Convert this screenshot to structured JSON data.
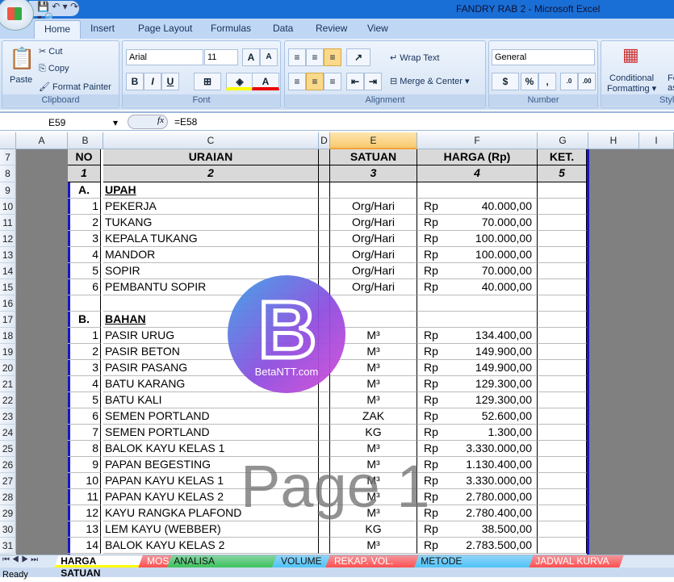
{
  "window": {
    "title": "FANDRY RAB 2 - Microsoft Excel",
    "qat": "💾 ↶ ▾ ↷ ▾ 🔍"
  },
  "ribbon_tabs": [
    "Home",
    "Insert",
    "Page Layout",
    "Formulas",
    "Data",
    "Review",
    "View"
  ],
  "ribbon": {
    "clipboard": {
      "label": "Clipboard",
      "paste": "Paste",
      "cut": "Cut",
      "copy": "Copy",
      "format_painter": "Format Painter"
    },
    "font": {
      "label": "Font",
      "name": "Arial",
      "size": "11"
    },
    "alignment": {
      "label": "Alignment",
      "wrap": "Wrap Text",
      "merge": "Merge & Center"
    },
    "number": {
      "label": "Number",
      "format": "General"
    },
    "styles": {
      "label": "Styles",
      "conditional": "Conditional",
      "formatting": "Formatting",
      "format_as": "Fo",
      "as_table": "as T"
    }
  },
  "formula_bar": {
    "name_box": "E59",
    "fx": "fx",
    "formula": "=E58"
  },
  "columns": [
    "A",
    "B",
    "C",
    "D",
    "E",
    "F",
    "G",
    "H",
    "I"
  ],
  "selected_column": "E",
  "header_row": {
    "no": "NO",
    "uraian": "URAIAN",
    "satuan": "SATUAN",
    "harga": "HARGA (Rp)",
    "ket": "KET."
  },
  "number_row": [
    "1",
    "2",
    "3",
    "4",
    "5"
  ],
  "rows": [
    {
      "r": "9",
      "b": "A.",
      "c": "UPAH",
      "section": true
    },
    {
      "r": "10",
      "b": "1",
      "c": "PEKERJA",
      "e": "Org/Hari",
      "rp": "Rp",
      "f": "40.000,00"
    },
    {
      "r": "11",
      "b": "2",
      "c": "TUKANG",
      "e": "Org/Hari",
      "rp": "Rp",
      "f": "70.000,00"
    },
    {
      "r": "12",
      "b": "3",
      "c": "KEPALA TUKANG",
      "e": "Org/Hari",
      "rp": "Rp",
      "f": "100.000,00"
    },
    {
      "r": "13",
      "b": "4",
      "c": "MANDOR",
      "e": "Org/Hari",
      "rp": "Rp",
      "f": "100.000,00"
    },
    {
      "r": "14",
      "b": "5",
      "c": "SOPIR",
      "e": "Org/Hari",
      "rp": "Rp",
      "f": "70.000,00"
    },
    {
      "r": "15",
      "b": "6",
      "c": "PEMBANTU SOPIR",
      "e": "Org/Hari",
      "rp": "Rp",
      "f": "40.000,00"
    },
    {
      "r": "16"
    },
    {
      "r": "17",
      "b": "B.",
      "c": "BAHAN",
      "section": true
    },
    {
      "r": "18",
      "b": "1",
      "c": "PASIR URUG",
      "e": "M³",
      "rp": "Rp",
      "f": "134.400,00"
    },
    {
      "r": "19",
      "b": "2",
      "c": "PASIR BETON",
      "e": "M³",
      "rp": "Rp",
      "f": "149.900,00"
    },
    {
      "r": "20",
      "b": "3",
      "c": "PASIR PASANG",
      "e": "M³",
      "rp": "Rp",
      "f": "149.900,00"
    },
    {
      "r": "21",
      "b": "4",
      "c": "BATU KARANG",
      "e": "M³",
      "rp": "Rp",
      "f": "129.300,00"
    },
    {
      "r": "22",
      "b": "5",
      "c": "BATU KALI",
      "e": "M³",
      "rp": "Rp",
      "f": "129.300,00"
    },
    {
      "r": "23",
      "b": "6",
      "c": "SEMEN PORTLAND",
      "e": "ZAK",
      "rp": "Rp",
      "f": "52.600,00"
    },
    {
      "r": "24",
      "b": "7",
      "c": "SEMEN PORTLAND",
      "e": "KG",
      "rp": "Rp",
      "f": "1.300,00"
    },
    {
      "r": "25",
      "b": "8",
      "c": "BALOK KAYU KELAS 1",
      "e": "M³",
      "rp": "Rp",
      "f": "3.330.000,00"
    },
    {
      "r": "26",
      "b": "9",
      "c": "PAPAN BEGESTING",
      "e": "M³",
      "rp": "Rp",
      "f": "1.130.400,00"
    },
    {
      "r": "27",
      "b": "10",
      "c": "PAPAN KAYU KELAS 1",
      "e": "M³",
      "rp": "Rp",
      "f": "3.330.000,00"
    },
    {
      "r": "28",
      "b": "11",
      "c": "PAPAN KAYU KELAS 2",
      "e": "M³",
      "rp": "Rp",
      "f": "2.780.000,00"
    },
    {
      "r": "29",
      "b": "12",
      "c": "KAYU RANGKA PLAFOND",
      "e": "M³",
      "rp": "Rp",
      "f": "2.780.400,00"
    },
    {
      "r": "30",
      "b": "13",
      "c": "LEM KAYU (WEBBER)",
      "e": "KG",
      "rp": "Rp",
      "f": "38.500,00"
    },
    {
      "r": "31",
      "b": "14",
      "c": "BALOK KAYU KELAS 2",
      "e": "M³",
      "rp": "Rp",
      "f": "2.783.500,00"
    }
  ],
  "sheet_tabs": [
    {
      "label": "HARGA SATUAN",
      "color": "#ffff00",
      "active": true
    },
    {
      "label": "MOS",
      "color": "#ff4f4f"
    },
    {
      "label": "ANALISA ANGKUTAN",
      "color": "#3cc25c"
    },
    {
      "label": "VOLUME",
      "color": "#4fc3f7"
    },
    {
      "label": "REKAP. VOL.",
      "color": "#ff4f4f"
    },
    {
      "label": "METODE PELAKSANAAN",
      "color": "#4fc3f7"
    },
    {
      "label": "JADWAL KURVA S",
      "color": "#ff4f4f"
    }
  ],
  "status": "Ready",
  "watermark": {
    "logo_text": "BetaNTT.com",
    "logo_letter": "B",
    "page": "Page 1"
  }
}
